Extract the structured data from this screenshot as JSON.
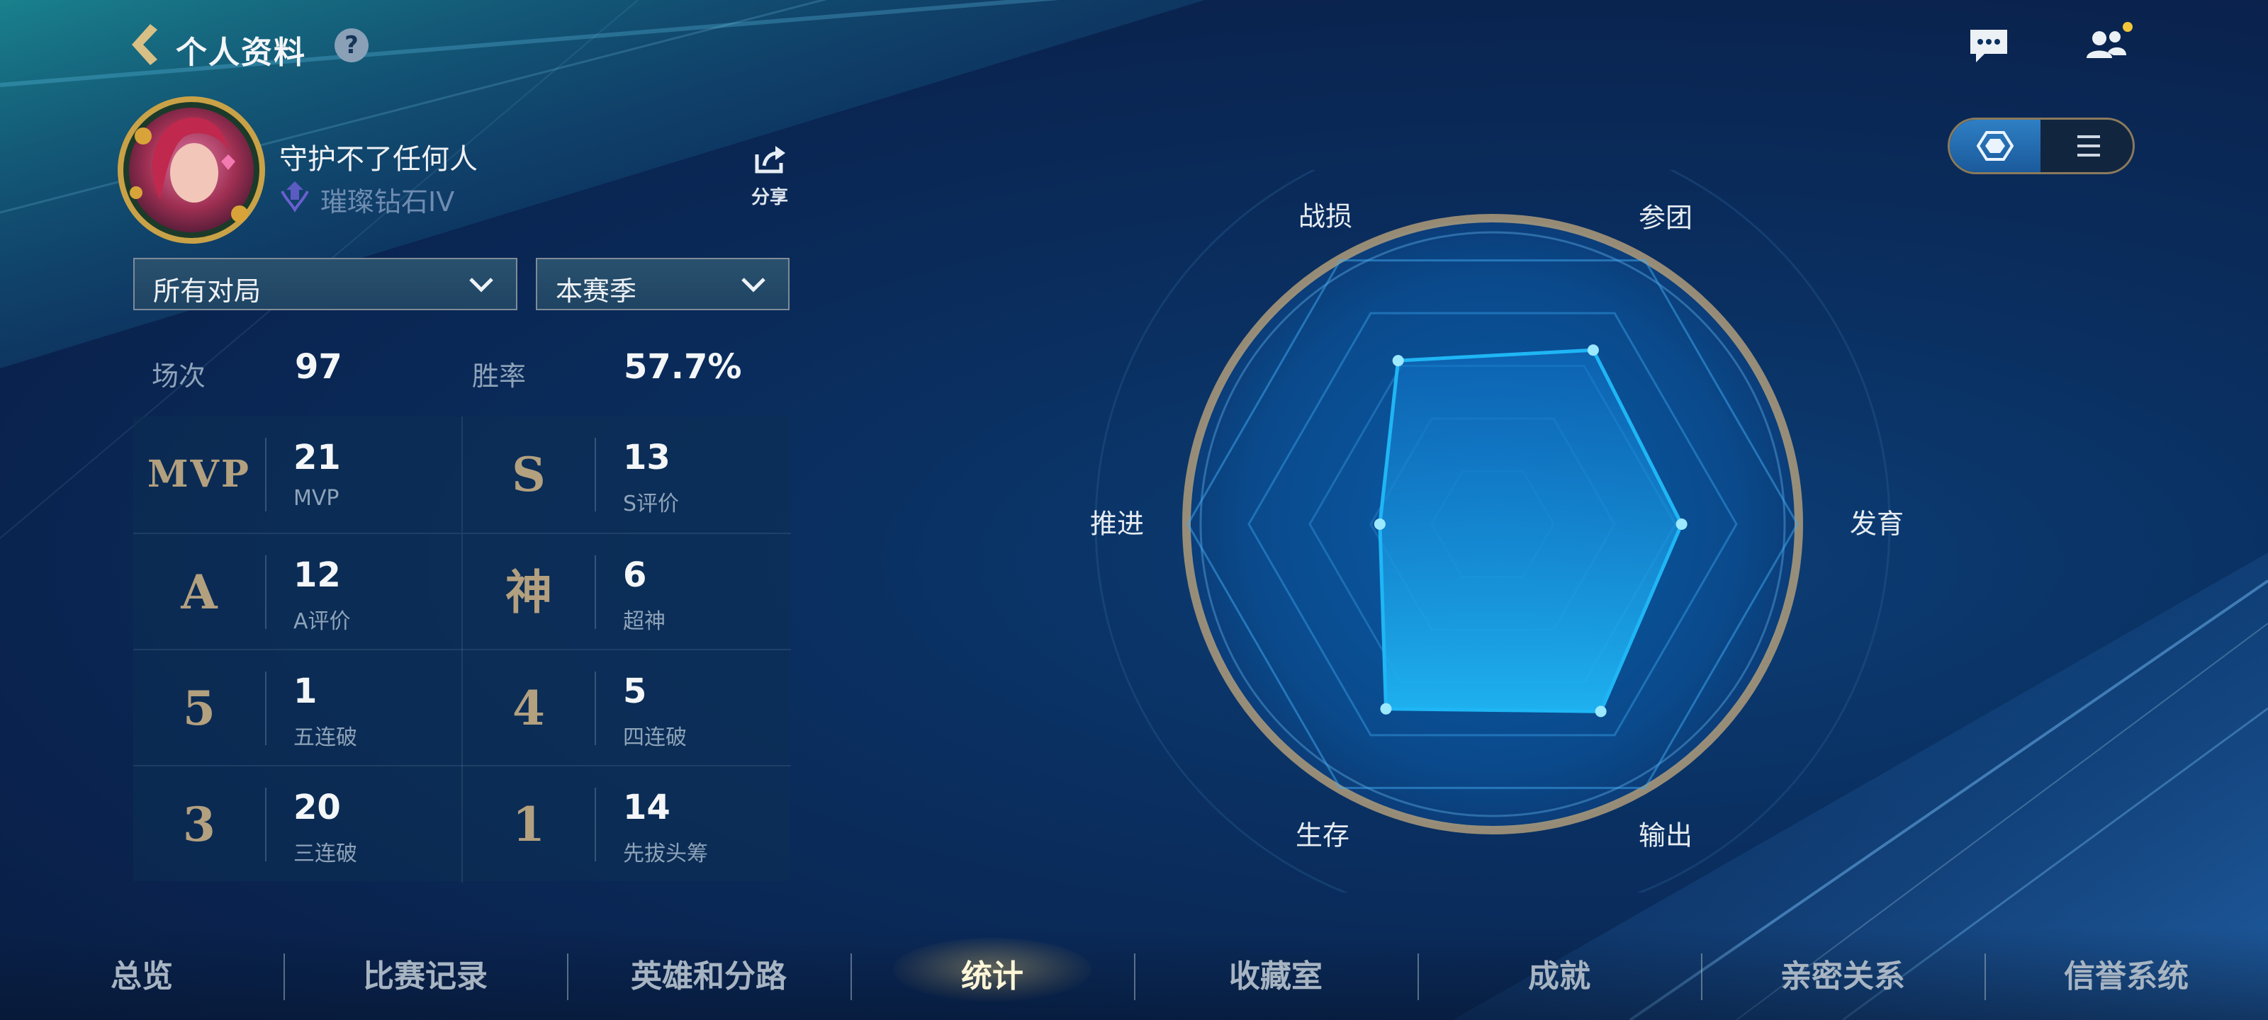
{
  "header": {
    "title": "个人资料",
    "help_icon": "help-icon",
    "chat_icon": "chat-icon",
    "friends_icon": "friends-icon"
  },
  "profile": {
    "player_name": "守护不了任何人",
    "rank": "璀璨钻石IV",
    "share_label": "分享"
  },
  "filters": {
    "mode": "所有对局",
    "season": "本赛季"
  },
  "summary": {
    "matches_label": "场次",
    "matches_value": "97",
    "winrate_label": "胜率",
    "winrate_value": "57.7%"
  },
  "stats": [
    {
      "badge": "MVP",
      "value": "21",
      "caption": "MVP"
    },
    {
      "badge": "S",
      "value": "13",
      "caption": "S评价"
    },
    {
      "badge": "A",
      "value": "12",
      "caption": "A评价"
    },
    {
      "badge": "神",
      "value": "6",
      "caption": "超神"
    },
    {
      "badge": "5",
      "value": "1",
      "caption": "五连破"
    },
    {
      "badge": "4",
      "value": "5",
      "caption": "四连破"
    },
    {
      "badge": "3",
      "value": "20",
      "caption": "三连破"
    },
    {
      "badge": "1",
      "value": "14",
      "caption": "先拔头筹"
    }
  ],
  "radar": {
    "axes": [
      "战损",
      "参团",
      "发育",
      "输出",
      "生存",
      "推进"
    ],
    "values": [
      0.62,
      0.66,
      0.62,
      0.71,
      0.7,
      0.37
    ],
    "fill_color": "#1fb6f5",
    "ring_color": "#b9a37c"
  },
  "view_toggle": {
    "active": "radar",
    "options": [
      "radar-icon",
      "list-icon"
    ]
  },
  "bottom_nav": {
    "tabs": [
      "总览",
      "比赛记录",
      "英雄和分路",
      "统计",
      "收藏室",
      "成就",
      "亲密关系",
      "信誉系统"
    ],
    "active_index": 3
  },
  "colors": {
    "background": "#0a2f60",
    "accent_gold": "#b3a07f",
    "text_muted": "#8ea3b9"
  }
}
